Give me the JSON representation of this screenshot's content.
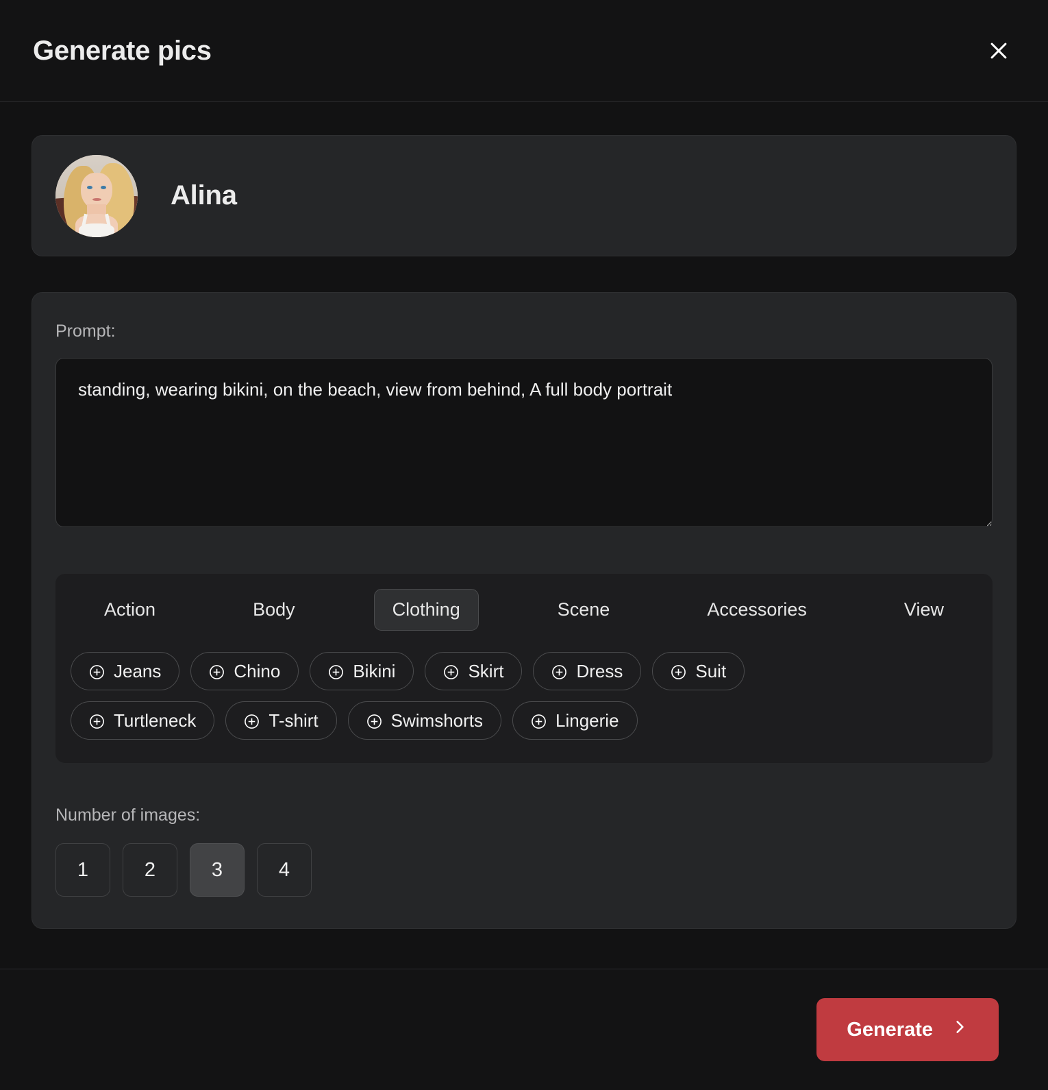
{
  "header": {
    "title": "Generate pics",
    "close_icon": "close-icon"
  },
  "profile": {
    "name": "Alina",
    "avatar_icon": "avatar"
  },
  "prompt": {
    "label": "Prompt:",
    "value": "standing, wearing bikini, on the beach, view from behind, A full body portrait",
    "placeholder": ""
  },
  "tabs": [
    {
      "label": "Action",
      "active": false
    },
    {
      "label": "Body",
      "active": false
    },
    {
      "label": "Clothing",
      "active": true
    },
    {
      "label": "Scene",
      "active": false
    },
    {
      "label": "Accessories",
      "active": false
    },
    {
      "label": "View",
      "active": false
    }
  ],
  "chips": {
    "add_icon": "plus-circle-icon",
    "row1": [
      {
        "label": "Jeans"
      },
      {
        "label": "Chino"
      },
      {
        "label": "Bikini"
      },
      {
        "label": "Skirt"
      },
      {
        "label": "Dress"
      },
      {
        "label": "Suit"
      }
    ],
    "row2": [
      {
        "label": "Turtleneck"
      },
      {
        "label": "T-shirt"
      },
      {
        "label": "Swimshorts"
      },
      {
        "label": "Lingerie"
      }
    ]
  },
  "image_count": {
    "label": "Number of images:",
    "options": [
      "1",
      "2",
      "3",
      "4"
    ],
    "selected": "3"
  },
  "footer": {
    "generate_label": "Generate",
    "chevron_icon": "chevron-right-icon"
  },
  "colors": {
    "accent": "#c03b40",
    "modal_bg": "#121213",
    "card_bg": "#252628",
    "panel_bg": "#1d1d1f",
    "border": "#2e2f31",
    "text_primary": "#ececec",
    "text_muted": "#b6b6b8"
  }
}
